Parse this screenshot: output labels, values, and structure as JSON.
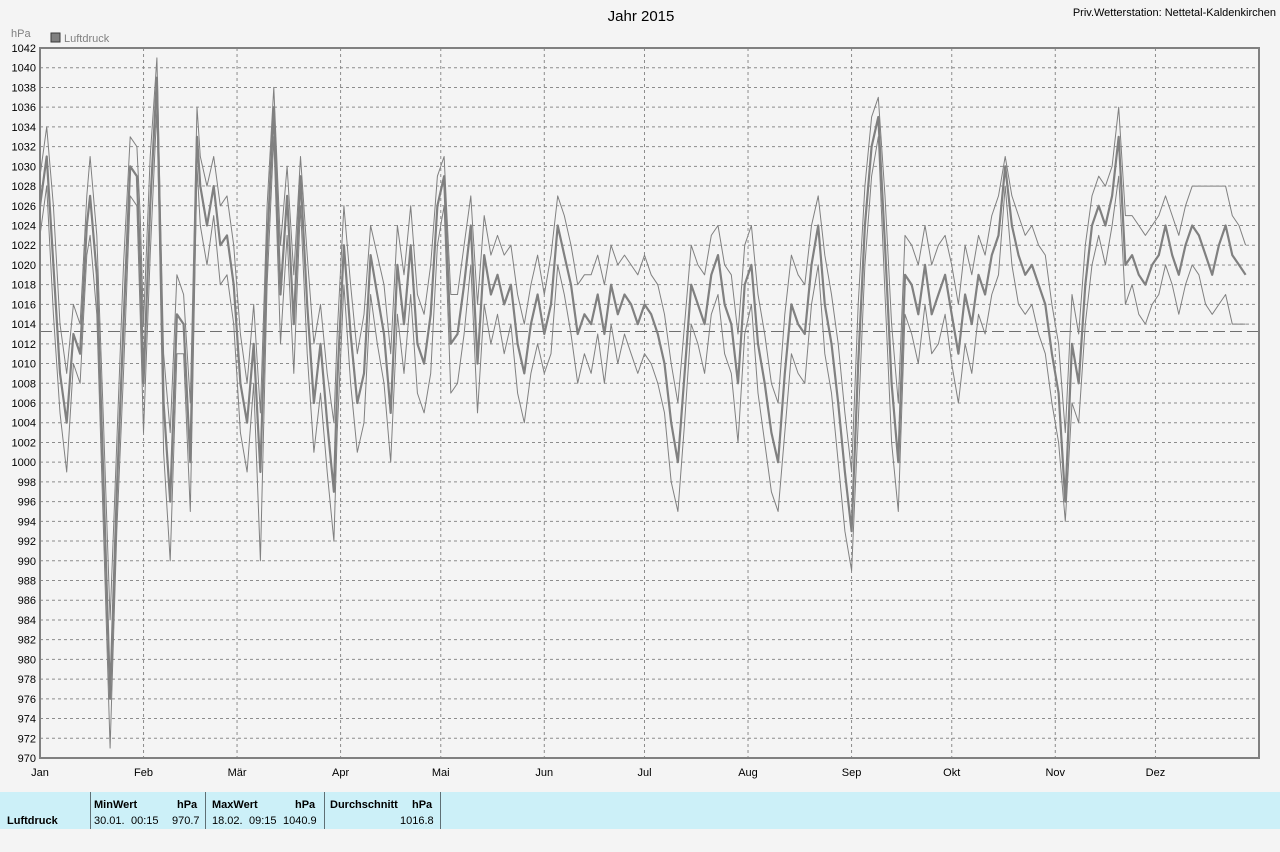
{
  "chart_data": {
    "type": "line",
    "title": "Jahr 2015",
    "station": "Priv.Wetterstation: Nettetal-Kaldenkirchen",
    "ylabel": "hPa",
    "ylim": [
      970,
      1042
    ],
    "ytick_step": 2,
    "reference_line": 1013.25,
    "x_ticks": [
      "Jan",
      "Feb",
      "Mär",
      "Apr",
      "Mai",
      "Jun",
      "Jul",
      "Aug",
      "Sep",
      "Okt",
      "Nov",
      "Dez"
    ],
    "x_tick_days": [
      0,
      31,
      59,
      90,
      120,
      151,
      181,
      212,
      243,
      273,
      304,
      334
    ],
    "x_range_days": [
      0,
      365
    ],
    "grid": true,
    "legend": [
      "Luftdruck"
    ],
    "legend_position": "top-left",
    "colors": {
      "series": "#808080",
      "background": "#f4f4f4",
      "grid": "#8c8c8c",
      "footer": "#ccf0f8"
    },
    "series": [
      {
        "name": "Luftdruck",
        "x": [
          0,
          2,
          4,
          6,
          8,
          10,
          12,
          14,
          15,
          17,
          19,
          21,
          23,
          25,
          27,
          29,
          30,
          31,
          33,
          35,
          37,
          39,
          41,
          43,
          45,
          47,
          48,
          50,
          52,
          54,
          56,
          58,
          60,
          62,
          64,
          66,
          68,
          70,
          72,
          74,
          76,
          78,
          80,
          82,
          84,
          86,
          88,
          89,
          91,
          93,
          95,
          97,
          99,
          101,
          103,
          105,
          107,
          109,
          111,
          113,
          115,
          117,
          119,
          121,
          123,
          125,
          127,
          129,
          131,
          133,
          135,
          137,
          139,
          141,
          143,
          145,
          147,
          149,
          151,
          153,
          155,
          157,
          159,
          161,
          163,
          165,
          167,
          169,
          171,
          173,
          175,
          177,
          179,
          181,
          183,
          185,
          187,
          189,
          191,
          193,
          195,
          197,
          199,
          201,
          203,
          205,
          207,
          209,
          211,
          213,
          215,
          217,
          219,
          221,
          223,
          225,
          227,
          229,
          231,
          233,
          235,
          237,
          239,
          241,
          243,
          245,
          247,
          249,
          251,
          253,
          255,
          257,
          259,
          261,
          263,
          265,
          267,
          269,
          271,
          273,
          275,
          277,
          279,
          281,
          283,
          285,
          287,
          289,
          291,
          293,
          295,
          297,
          299,
          301,
          303,
          305,
          307,
          309,
          311,
          313,
          315,
          317,
          319,
          321,
          323,
          325,
          327,
          329,
          331,
          333,
          335,
          337,
          339,
          341,
          343,
          345,
          347,
          349,
          351,
          353,
          355,
          357,
          359,
          361,
          363,
          365
        ],
        "mean": [
          1026,
          1031,
          1020,
          1009,
          1004,
          1013,
          1011,
          1024,
          1027,
          1019,
          998,
          976,
          997,
          1014,
          1030,
          1029,
          1020,
          1008,
          1026,
          1039,
          1006,
          996,
          1015,
          1014,
          1000,
          1033,
          1028,
          1024,
          1028,
          1022,
          1023,
          1018,
          1008,
          1004,
          1012,
          999,
          1022,
          1036,
          1017,
          1027,
          1014,
          1029,
          1016,
          1006,
          1012,
          1004,
          997,
          1008,
          1022,
          1013,
          1006,
          1009,
          1021,
          1017,
          1013,
          1005,
          1020,
          1014,
          1022,
          1012,
          1010,
          1015,
          1026,
          1029,
          1012,
          1013,
          1018,
          1024,
          1010,
          1021,
          1017,
          1019,
          1016,
          1018,
          1012,
          1009,
          1014,
          1017,
          1013,
          1016,
          1024,
          1021,
          1018,
          1013,
          1015,
          1014,
          1017,
          1013,
          1018,
          1015,
          1017,
          1016,
          1014,
          1016,
          1015,
          1013,
          1010,
          1004,
          1000,
          1009,
          1018,
          1016,
          1014,
          1019,
          1021,
          1016,
          1014,
          1008,
          1018,
          1020,
          1012,
          1008,
          1003,
          1000,
          1009,
          1016,
          1014,
          1013,
          1020,
          1024,
          1016,
          1012,
          1006,
          999,
          993,
          1010,
          1024,
          1032,
          1035,
          1022,
          1008,
          1000,
          1019,
          1018,
          1015,
          1020,
          1015,
          1017,
          1019,
          1015,
          1011,
          1017,
          1014,
          1019,
          1017,
          1021,
          1023,
          1030,
          1024,
          1021,
          1019,
          1020,
          1018,
          1016,
          1011,
          1007,
          996,
          1012,
          1008,
          1018,
          1024,
          1026,
          1024,
          1027,
          1033,
          1020,
          1021,
          1019,
          1018,
          1020,
          1021,
          1024,
          1021,
          1019,
          1022,
          1024,
          1023,
          1021,
          1019,
          1022,
          1024,
          1021,
          1020,
          1019
        ],
        "upper": [
          1029,
          1034,
          1026,
          1014,
          1009,
          1016,
          1014,
          1027,
          1031,
          1023,
          1004,
          984,
          1002,
          1020,
          1033,
          1032,
          1025,
          1014,
          1031,
          1041,
          1011,
          1003,
          1019,
          1017,
          1006,
          1036,
          1031,
          1028,
          1031,
          1026,
          1027,
          1022,
          1013,
          1008,
          1016,
          1005,
          1026,
          1038,
          1022,
          1030,
          1019,
          1031,
          1021,
          1012,
          1016,
          1009,
          1004,
          1013,
          1026,
          1018,
          1011,
          1015,
          1024,
          1021,
          1018,
          1011,
          1024,
          1019,
          1026,
          1017,
          1015,
          1020,
          1029,
          1031,
          1017,
          1017,
          1022,
          1027,
          1016,
          1025,
          1021,
          1023,
          1021,
          1022,
          1017,
          1014,
          1018,
          1021,
          1017,
          1021,
          1027,
          1025,
          1022,
          1018,
          1019,
          1019,
          1021,
          1018,
          1022,
          1020,
          1021,
          1020,
          1019,
          1021,
          1019,
          1018,
          1015,
          1010,
          1006,
          1014,
          1022,
          1020,
          1019,
          1023,
          1024,
          1020,
          1019,
          1013,
          1022,
          1024,
          1017,
          1013,
          1008,
          1006,
          1015,
          1021,
          1019,
          1018,
          1024,
          1027,
          1021,
          1017,
          1012,
          1005,
          999,
          1016,
          1028,
          1035,
          1037,
          1027,
          1014,
          1006,
          1023,
          1022,
          1020,
          1024,
          1020,
          1022,
          1023,
          1020,
          1016,
          1022,
          1019,
          1023,
          1021,
          1025,
          1027,
          1031,
          1027,
          1025,
          1023,
          1024,
          1022,
          1021,
          1016,
          1012,
          1003,
          1017,
          1013,
          1022,
          1027,
          1029,
          1028,
          1030,
          1036,
          1025,
          1025,
          1024,
          1023,
          1024,
          1025,
          1027,
          1025,
          1023,
          1026,
          1028,
          1028,
          1028,
          1028,
          1028,
          1028,
          1025,
          1024,
          1022
        ],
        "lower": [
          1023,
          1028,
          1015,
          1005,
          999,
          1010,
          1008,
          1021,
          1023,
          1015,
          993,
          971,
          993,
          1009,
          1027,
          1026,
          1015,
          1003,
          1021,
          1036,
          1001,
          990,
          1011,
          1011,
          995,
          1030,
          1024,
          1020,
          1025,
          1018,
          1019,
          1014,
          1003,
          999,
          1008,
          990,
          1018,
          1033,
          1012,
          1023,
          1009,
          1026,
          1011,
          1001,
          1007,
          999,
          992,
          1003,
          1018,
          1008,
          1001,
          1004,
          1017,
          1012,
          1008,
          1000,
          1015,
          1009,
          1017,
          1007,
          1005,
          1009,
          1022,
          1026,
          1007,
          1008,
          1013,
          1020,
          1005,
          1016,
          1012,
          1015,
          1011,
          1014,
          1007,
          1004,
          1009,
          1012,
          1009,
          1011,
          1020,
          1017,
          1013,
          1008,
          1011,
          1009,
          1013,
          1008,
          1014,
          1010,
          1013,
          1011,
          1009,
          1011,
          1010,
          1008,
          1005,
          998,
          995,
          1004,
          1014,
          1012,
          1009,
          1015,
          1017,
          1011,
          1009,
          1002,
          1013,
          1016,
          1007,
          1002,
          997,
          995,
          1003,
          1011,
          1009,
          1008,
          1016,
          1020,
          1011,
          1007,
          1000,
          993,
          989,
          1004,
          1020,
          1029,
          1033,
          1017,
          1002,
          995,
          1015,
          1013,
          1010,
          1016,
          1011,
          1012,
          1015,
          1010,
          1006,
          1012,
          1009,
          1015,
          1013,
          1017,
          1019,
          1028,
          1020,
          1016,
          1015,
          1016,
          1013,
          1011,
          1006,
          1002,
          994,
          1006,
          1004,
          1014,
          1020,
          1023,
          1020,
          1024,
          1029,
          1016,
          1018,
          1015,
          1014,
          1016,
          1017,
          1020,
          1018,
          1015,
          1018,
          1020,
          1019,
          1016,
          1015,
          1016,
          1017,
          1014,
          1014,
          1014
        ]
      }
    ]
  },
  "footer": {
    "series_label": "Luftdruck",
    "min_header": "MinWert",
    "min_unit": "hPa",
    "min_date": "30.01.",
    "min_time": "00:15",
    "min_value": "970.7",
    "max_header": "MaxWert",
    "max_unit": "hPa",
    "max_date": "18.02.",
    "max_time": "09:15",
    "max_value": "1040.9",
    "avg_header": "Durchschnitt",
    "avg_unit": "hPa",
    "avg_value": "1016.8"
  }
}
